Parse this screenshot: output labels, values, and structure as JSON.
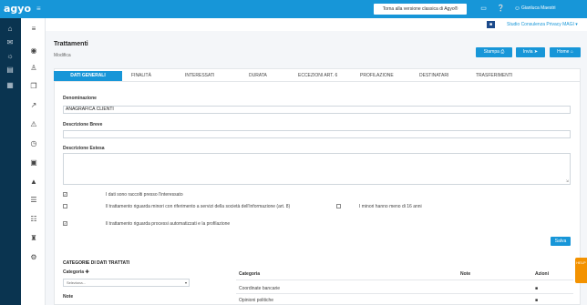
{
  "topbar": {
    "logo": "agyo",
    "logo_sub": "≡",
    "classic_button": "Torna alla versione classica di Agyo®",
    "icons": [
      "document-icon",
      "help-icon",
      "user-icon"
    ],
    "user_name": "Gianluca Maestri"
  },
  "sidebar": {
    "icons": [
      "home-icon",
      "mail-icon",
      "globe-icon",
      "invoice-icon",
      "apps-icon"
    ]
  },
  "subnav": {
    "icons": [
      "menu-icon",
      "dashboard-icon",
      "person-icon",
      "copy-icon",
      "share-icon",
      "warning-icon",
      "clock-icon",
      "calendar-icon",
      "announce-icon",
      "doc-list-icon",
      "report-icon",
      "graduation-icon",
      "settings-icon"
    ]
  },
  "studio": {
    "button_glyph": "■",
    "name": "Studio Consulenza Privacy MAGI ▾"
  },
  "header": {
    "title": "Trattamenti",
    "subtitle": "Modifica",
    "actions": {
      "stampa": "Stampa",
      "invia": "Invia",
      "home": "Home"
    }
  },
  "tabs": [
    "DATI GENERALI",
    "FINALITÀ",
    "INTERESSATI",
    "DURATA",
    "ECCEZIONI ART. 6",
    "PROFILAZIONE",
    "DESTINATARI",
    "TRASFERIMENTI"
  ],
  "form": {
    "denominazione_label": "Denominazione",
    "denominazione_value": "ANAGRAFICA CLIENTI",
    "descrizione_breve_label": "Descrizione Breve",
    "descrizione_breve_value": "",
    "descrizione_estesa_label": "Descrizione Estesa",
    "checkboxes": [
      {
        "label": "I dati sono raccolti presso l'interessato",
        "checked": true
      },
      {
        "label": "Il trattamento riguarda minori con riferimento a servizi della società dell'informazione (art. 8)",
        "checked": false
      },
      {
        "label": "Il trattamento riguarda processi automatizzati e la profilazione",
        "checked": true
      },
      {
        "label": "I minori hanno meno di 16 anni",
        "checked": false
      }
    ],
    "save_label": "Salva"
  },
  "categorie": {
    "section_title": "CATEGORIE DI DATI TRATTATI",
    "categoria_label": "Categoria",
    "select_placeholder": "Seleziona...",
    "note_label": "Note",
    "table_headers": {
      "categoria": "Categoria",
      "note": "Note",
      "azioni": "Azioni"
    },
    "rows": [
      {
        "categoria": "Coordinate bancarie",
        "note": ""
      },
      {
        "categoria": "Opinioni politiche",
        "note": ""
      }
    ]
  },
  "help_tab": "HELP"
}
